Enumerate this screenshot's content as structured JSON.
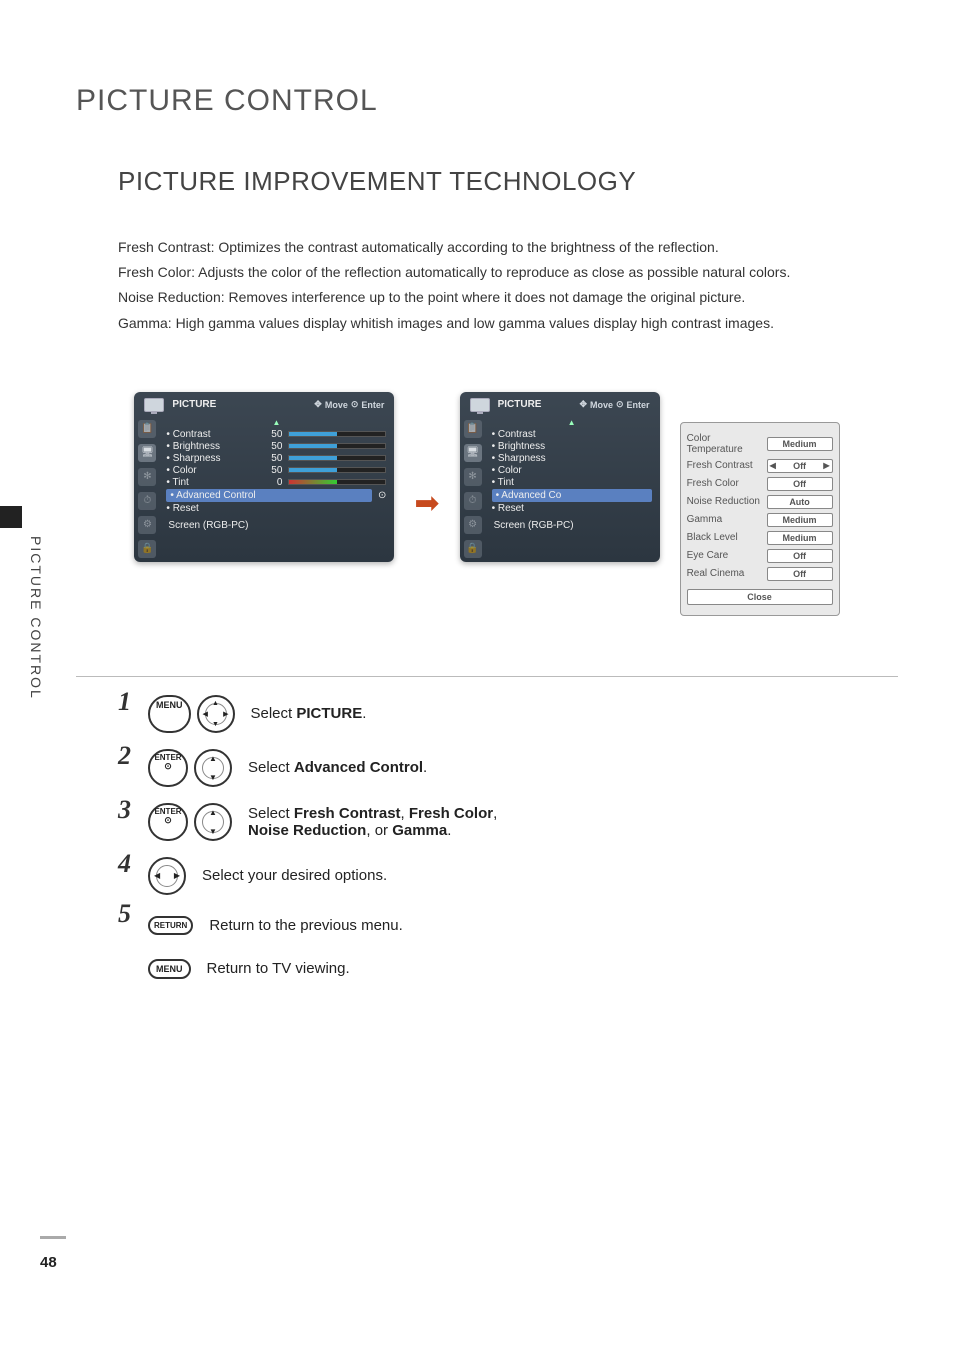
{
  "page": {
    "number": "48",
    "title": "PICTURE CONTROL",
    "section": "PICTURE IMPROVEMENT TECHNOLOGY",
    "side_tab": "PICTURE CONTROL"
  },
  "intro": [
    "Fresh Contrast: Optimizes the contrast automatically according to the brightness of the reflection.",
    "Fresh Color: Adjusts the color of the reflection automatically to reproduce as close as possible natural colors.",
    "Noise Reduction: Removes interference up to the point where it does not damage the original picture.",
    "Gamma: High gamma values display whitish images and low gamma values display high contrast images."
  ],
  "osd": {
    "title": "PICTURE",
    "ctl_move": "Move",
    "ctl_enter": "Enter",
    "items": {
      "contrast": {
        "label": "• Contrast",
        "value": "50"
      },
      "brightness": {
        "label": "• Brightness",
        "value": "50"
      },
      "sharpness": {
        "label": "• Sharpness",
        "value": "50"
      },
      "color": {
        "label": "• Color",
        "value": "50"
      },
      "tint": {
        "label": "• Tint",
        "value": "0"
      },
      "advanced": {
        "label": "• Advanced Control"
      },
      "advanced_short": {
        "label": "• Advanced Co"
      },
      "reset": {
        "label": "• Reset"
      },
      "screen": {
        "label": "Screen (RGB-PC)"
      }
    }
  },
  "popup": {
    "colortemp": {
      "label": "Color Temperature",
      "value": "Medium"
    },
    "freshcontrast": {
      "label": "Fresh Contrast",
      "value": "Off"
    },
    "freshcolor": {
      "label": "Fresh Color",
      "value": "Off"
    },
    "noise": {
      "label": "Noise Reduction",
      "value": "Auto"
    },
    "gamma": {
      "label": "Gamma",
      "value": "Medium"
    },
    "blacklevel": {
      "label": "Black Level",
      "value": "Medium"
    },
    "eyecare": {
      "label": "Eye Care",
      "value": "Off"
    },
    "realcinema": {
      "label": "Real Cinema",
      "value": "Off"
    },
    "close": "Close"
  },
  "buttons": {
    "menu": "MENU",
    "enter": "ENTER",
    "return": "RETURN"
  },
  "steps": {
    "s1_pre": "Select ",
    "s1_bold": "PICTURE",
    "s1_post": ".",
    "s2_pre": "Select ",
    "s2_bold": "Advanced Control",
    "s2_post": ".",
    "s3_pre": "Select ",
    "s3_b1": "Fresh Contrast",
    "s3_m1": ", ",
    "s3_b2": "Fresh Color",
    "s3_m2": ", ",
    "s3_b3": "Noise Reduction",
    "s3_m3": ", or ",
    "s3_b4": "Gamma",
    "s3_post": ".",
    "s4": "Select your desired options.",
    "s5": "Return to the previous menu.",
    "s6": "Return to TV viewing."
  },
  "nums": {
    "n1": "1",
    "n2": "2",
    "n3": "3",
    "n4": "4",
    "n5": "5"
  }
}
